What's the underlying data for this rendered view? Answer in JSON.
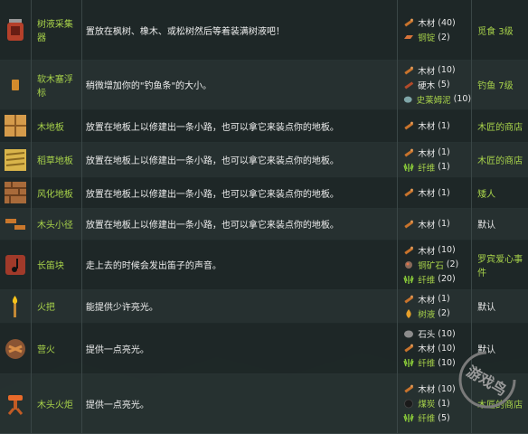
{
  "rows": [
    {
      "name": "树液采集器",
      "desc": "置放在枫树、橡木、或松树然后等着装满树液吧！",
      "materials": [
        {
          "icon": "wood-icon",
          "name": "木材",
          "qty": "(40)"
        },
        {
          "icon": "copper-bar-icon",
          "name": "铜锭",
          "qty": "(2)",
          "green": true
        }
      ],
      "source": "觅食 3级",
      "source_green": true
    },
    {
      "name": "软木塞浮标",
      "desc": "稍微增加你的\"钓鱼条\"的大小。",
      "materials": [
        {
          "icon": "wood-icon",
          "name": "木材",
          "qty": "(10)"
        },
        {
          "icon": "hardwood-icon",
          "name": "硬木",
          "qty": "(5)"
        },
        {
          "icon": "slime-icon",
          "name": "史莱姆泥",
          "qty": "(10)",
          "green": true
        }
      ],
      "source": "钓鱼 7级",
      "source_green": true
    },
    {
      "name": "木地板",
      "desc": "放置在地板上以修建出一条小路，也可以拿它来装点你的地板。",
      "materials": [
        {
          "icon": "wood-icon",
          "name": "木材",
          "qty": "(1)"
        }
      ],
      "source": "木匠的商店",
      "source_green": true
    },
    {
      "name": "稻草地板",
      "desc": "放置在地板上以修建出一条小路，也可以拿它来装点你的地板。",
      "materials": [
        {
          "icon": "wood-icon",
          "name": "木材",
          "qty": "(1)"
        },
        {
          "icon": "fiber-icon",
          "name": "纤维",
          "qty": "(1)",
          "green": true
        }
      ],
      "source": "木匠的商店",
      "source_green": true
    },
    {
      "name": "风化地板",
      "desc": "放置在地板上以修建出一条小路，也可以拿它来装点你的地板。",
      "materials": [
        {
          "icon": "wood-icon",
          "name": "木材",
          "qty": "(1)"
        }
      ],
      "source": "矮人",
      "source_green": true
    },
    {
      "name": "木头小径",
      "desc": "放置在地板上以修建出一条小路，也可以拿它来装点你的地板。",
      "materials": [
        {
          "icon": "wood-icon",
          "name": "木材",
          "qty": "(1)"
        }
      ],
      "source": "默认",
      "source_green": false
    },
    {
      "name": "长笛块",
      "desc": "走上去的时候会发出笛子的声音。",
      "materials": [
        {
          "icon": "wood-icon",
          "name": "木材",
          "qty": "(10)"
        },
        {
          "icon": "copper-ore-icon",
          "name": "铜矿石",
          "qty": "(2)",
          "green": true
        },
        {
          "icon": "fiber-icon",
          "name": "纤维",
          "qty": "(20)",
          "green": true
        }
      ],
      "source": "罗宾爱心事件",
      "source_green": true
    },
    {
      "name": "火把",
      "desc": "能提供少许亮光。",
      "materials": [
        {
          "icon": "wood-icon",
          "name": "木材",
          "qty": "(1)"
        },
        {
          "icon": "sap-icon",
          "name": "树液",
          "qty": "(2)",
          "green": true
        }
      ],
      "source": "默认",
      "source_green": false
    },
    {
      "name": "营火",
      "desc": "提供一点亮光。",
      "materials": [
        {
          "icon": "stone-icon",
          "name": "石头",
          "qty": "(10)"
        },
        {
          "icon": "wood-icon",
          "name": "木材",
          "qty": "(10)"
        },
        {
          "icon": "fiber-icon",
          "name": "纤维",
          "qty": "(10)",
          "green": true
        }
      ],
      "source": "默认",
      "source_green": false
    },
    {
      "name": "木头火炬",
      "desc": "提供一点亮光。",
      "materials": [
        {
          "icon": "wood-icon",
          "name": "木材",
          "qty": "(10)"
        },
        {
          "icon": "coal-icon",
          "name": "煤炭",
          "qty": "(1)",
          "green": true
        },
        {
          "icon": "fiber-icon",
          "name": "纤维",
          "qty": "(5)",
          "green": true
        }
      ],
      "source": "木匠的商店",
      "source_green": true
    }
  ],
  "watermark": "游戏鸟"
}
